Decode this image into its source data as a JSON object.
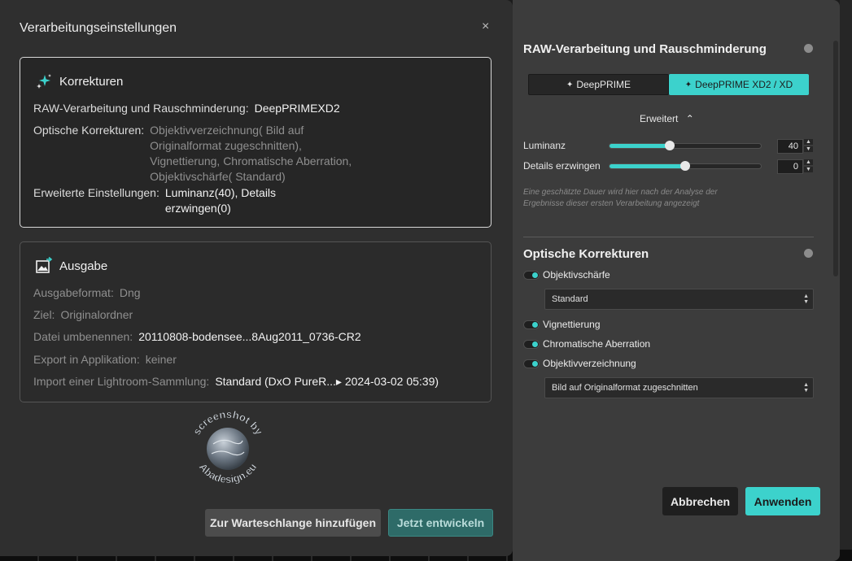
{
  "dialog": {
    "title": "Verarbeitungseinstellungen",
    "close_label": "×",
    "corrections": {
      "heading": "Korrekturen",
      "raw_label": "RAW-Verarbeitung und Rauschminderung:",
      "raw_value": "DeepPRIMEXD2",
      "optical_label": "Optische Korrekturen:",
      "optical_lines": [
        "Objektivverzeichnung( Bild auf",
        "Originalformat zugeschnitten),",
        "Vignettierung, Chromatische Aberration,",
        "Objektivschärfe( Standard)"
      ],
      "advanced_label": "Erweiterte Einstellungen:",
      "advanced_lines": [
        "Luminanz(40), Details",
        "erzwingen(0)"
      ]
    },
    "output": {
      "heading": "Ausgabe",
      "format_label": "Ausgabeformat:",
      "format_value": "Dng",
      "target_label": "Ziel:",
      "target_value": "Originalordner",
      "rename_label": "Datei umbenennen:",
      "rename_value": "20110808-bodensee...8Aug2011_0736-CR2",
      "export_label": "Export in Applikation:",
      "export_value": "keiner",
      "import_label": "Import einer Lightroom-Sammlung:",
      "import_value": "Standard (DxO PureR...▸ 2024-03-02 05:39)"
    },
    "queue_button": "Zur Warteschlange hinzufügen",
    "develop_button": "Jetzt entwickeln",
    "watermark_text": "screenshot by Abadesign.eu"
  },
  "panel": {
    "title": "RAW-Verarbeitung und Rauschminderung",
    "seg_left": "DeepPRIME",
    "seg_right": "DeepPRIME XD2 / XD",
    "advanced_label": "Erweitert",
    "advanced_chevron": "⌃",
    "luminance_label": "Luminanz",
    "luminance_value": "40",
    "luminance_level": 0.4,
    "details_label": "Details erzwingen",
    "details_value": "0",
    "details_level": 0.5,
    "note": "Eine geschätzte Dauer wird hier nach der Analyse der Ergebnisse dieser ersten Verarbeitung angezeigt",
    "optical_title": "Optische Korrekturen",
    "sharpness_label": "Objektivschärfe",
    "sharpness_select": "Standard",
    "vignetting_label": "Vignettierung",
    "chromatic_label": "Chromatische Aberration",
    "distortion_label": "Objektivverzeichnung",
    "distortion_select": "Bild auf Originalformat zugeschnitten",
    "cancel_button": "Abbrechen",
    "apply_button": "Anwenden"
  },
  "colors": {
    "accent": "#3cd2cc",
    "dialog_bg": "#2f2f2f",
    "panel_bg": "#3c3c3c"
  }
}
